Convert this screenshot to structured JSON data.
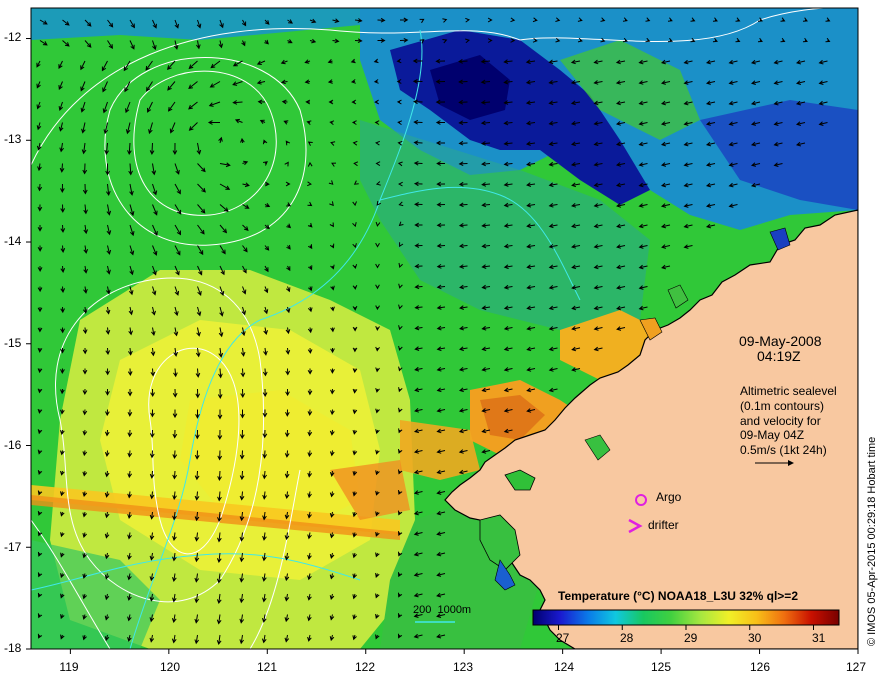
{
  "date_line1": "09-May-2008",
  "date_line2": "04:19Z",
  "altimetry": {
    "line1": "Altimetric sealevel",
    "line2": "(0.1m contours)",
    "line3": "and velocity for",
    "line4": "09-May 04Z",
    "scale_label": "0.5m/s (1kt 24h)"
  },
  "legend": {
    "argo_label": "Argo",
    "drifter_label": "drifter",
    "argo_color": "#e020e0",
    "drifter_color": "#e020e0"
  },
  "isobath_label": "200  1000m",
  "credit": "© IMOS 05-Apr-2015 00:29:18 Hobart time",
  "colorbar": {
    "title": "Temperature (°C) NOAA18_L3U 32% ql>=2",
    "ticks": [
      "27",
      "28",
      "29",
      "30",
      "31"
    ],
    "tick_values": [
      27,
      28,
      29,
      30,
      31
    ],
    "range": [
      26.6,
      31.4
    ],
    "colors": [
      "#00006e",
      "#1a1ad0",
      "#0a7ae8",
      "#10c8e0",
      "#18c860",
      "#40d040",
      "#a8e840",
      "#f0f028",
      "#f8c018",
      "#f07010",
      "#c81000",
      "#780000"
    ]
  },
  "axes": {
    "lon_ticks": [
      "119",
      "120",
      "121",
      "122",
      "123",
      "124",
      "125",
      "126",
      "127"
    ],
    "lon_values": [
      119,
      120,
      121,
      122,
      123,
      124,
      125,
      126,
      127
    ],
    "lat_ticks": [
      "-12",
      "-13",
      "-14",
      "-15",
      "-16",
      "-17",
      "-18"
    ],
    "lat_values": [
      -12,
      -13,
      -14,
      -15,
      -16,
      -17,
      -18
    ],
    "lon_range": [
      118.6,
      127
    ],
    "lat_range": [
      -18,
      -11.7
    ]
  },
  "colors": {
    "land": "#f8c8a0",
    "coast": "#000000",
    "arrow": "#000000",
    "sealevel_contour": "#ffffff",
    "isobath_200": "#40e8e8",
    "isobath_1000": "#40e8e8"
  }
}
